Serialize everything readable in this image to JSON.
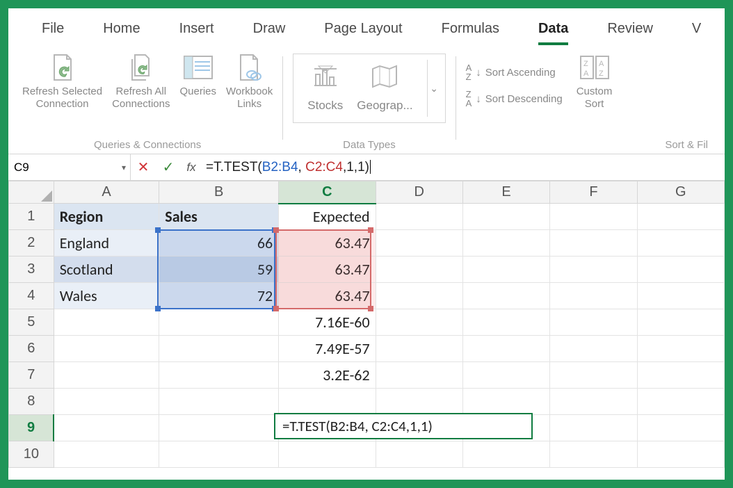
{
  "tabs": {
    "file": "File",
    "home": "Home",
    "insert": "Insert",
    "draw": "Draw",
    "page_layout": "Page Layout",
    "formulas": "Formulas",
    "data": "Data",
    "review": "Review",
    "view": "V"
  },
  "ribbon": {
    "queries_conn": {
      "label": "Queries & Connections",
      "refresh_selected": {
        "l1": "Refresh Selected",
        "l2": "Connection"
      },
      "refresh_all": {
        "l1": "Refresh All",
        "l2": "Connections"
      },
      "queries": "Queries",
      "workbook_links": {
        "l1": "Workbook",
        "l2": "Links"
      }
    },
    "data_types": {
      "label": "Data Types",
      "stocks": "Stocks",
      "geography": "Geograp..."
    },
    "sort_filter": {
      "label": "Sort & Fil",
      "asc": "Sort Ascending",
      "desc": "Sort Descending",
      "custom": {
        "l1": "Custom",
        "l2": "Sort"
      }
    }
  },
  "formula_bar": {
    "cell_ref": "C9",
    "prefix": "=T.TEST(",
    "range1": "B2:B4",
    "sep": ", ",
    "range2": "C2:C4",
    "suffix": ",1,1)"
  },
  "columns": [
    "A",
    "B",
    "C",
    "D",
    "E",
    "F",
    "G"
  ],
  "rows": [
    "1",
    "2",
    "3",
    "4",
    "5",
    "6",
    "7",
    "8",
    "9",
    "10"
  ],
  "sheet": {
    "A1": "Region",
    "B1": "Sales",
    "C1": "Expected",
    "A2": "England",
    "B2": "66",
    "C2": "63.47",
    "A3": "Scotland",
    "B3": "59",
    "C3": "63.47",
    "A4": "Wales",
    "B4": "72",
    "C4": "63.47",
    "C5": "7.16E-60",
    "C6": "7.49E-57",
    "C7": "3.2E-62",
    "C9_tip": "=T.TEST(B2:B4, C2:C4,1,1)"
  }
}
